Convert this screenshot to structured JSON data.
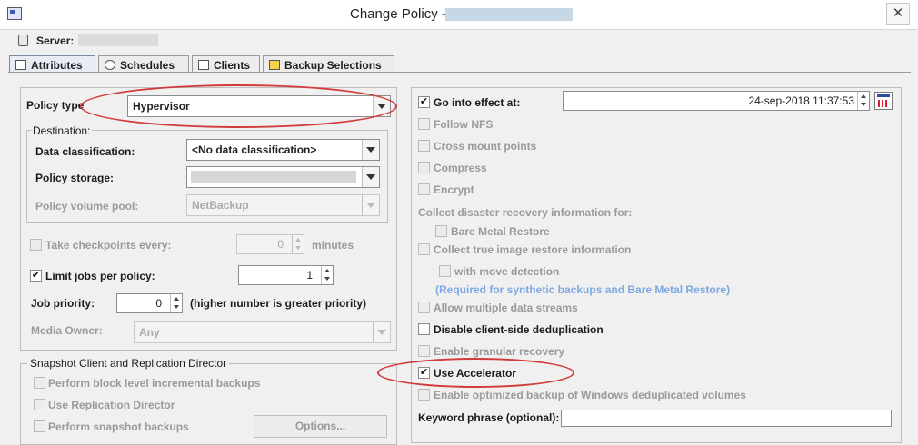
{
  "window": {
    "title": "Change Policy -",
    "close_glyph": "✕"
  },
  "server": {
    "label": "Server:"
  },
  "tabs": [
    {
      "label": "Attributes",
      "icon": "attributes-icon",
      "active": true
    },
    {
      "label": "Schedules",
      "icon": "clock-icon"
    },
    {
      "label": "Clients",
      "icon": "clients-icon"
    },
    {
      "label": "Backup Selections",
      "icon": "backup-selections-icon"
    }
  ],
  "left": {
    "policy_type_label": "Policy type",
    "policy_type_value": "Hypervisor",
    "destination_title": "Destination:",
    "data_classification_label": "Data classification:",
    "data_classification_value": "<No data classification>",
    "policy_storage_label": "Policy storage:",
    "policy_volume_pool_label": "Policy volume pool:",
    "policy_volume_pool_value": "NetBackup",
    "take_checkpoints_label": "Take checkpoints every:",
    "take_checkpoints_value": "0",
    "minutes_label": "minutes",
    "limit_jobs_label": "Limit jobs per policy:",
    "limit_jobs_value": "1",
    "job_priority_label": "Job priority:",
    "job_priority_value": "0",
    "priority_hint": "(higher number is greater priority)",
    "media_owner_label": "Media Owner:",
    "media_owner_value": "Any",
    "snapshot_title": "Snapshot Client and Replication Director",
    "perform_block_label": "Perform block level incremental backups",
    "use_replication_label": "Use Replication Director",
    "perform_snapshot_label": "Perform snapshot backups",
    "options_button": "Options..."
  },
  "right": {
    "go_into_effect_label": "Go into effect at:",
    "go_into_effect_value": "24-sep-2018 11:37:53",
    "follow_nfs_label": "Follow NFS",
    "cross_mount_label": "Cross mount points",
    "compress_label": "Compress",
    "encrypt_label": "Encrypt",
    "collect_dr_label": "Collect disaster recovery information for:",
    "bare_metal_label": "Bare Metal Restore",
    "collect_tir_label": "Collect true image restore information",
    "with_move_label": "with move detection",
    "required_note": "(Required for synthetic backups and Bare Metal Restore)",
    "allow_streams_label": "Allow multiple data streams",
    "disable_dedup_label": "Disable client-side deduplication",
    "granular_label": "Enable granular recovery",
    "accelerator_label": "Use Accelerator",
    "optimized_label": "Enable optimized backup of Windows deduplicated volumes",
    "keyword_label": "Keyword phrase (optional):"
  },
  "checks": {
    "take_checkpoints": false,
    "limit_jobs": true,
    "perform_block": false,
    "use_replication": false,
    "perform_snapshot": false,
    "go_into_effect": true,
    "follow_nfs": false,
    "cross_mount": false,
    "compress": false,
    "encrypt": false,
    "bare_metal": false,
    "collect_tir": false,
    "with_move": false,
    "allow_streams": false,
    "disable_dedup": false,
    "granular": false,
    "accelerator": true,
    "optimized": false
  },
  "colors": {
    "highlight": "#d23b3b",
    "info_text": "#7ea8e0",
    "active_tab": "#e8edf5"
  }
}
